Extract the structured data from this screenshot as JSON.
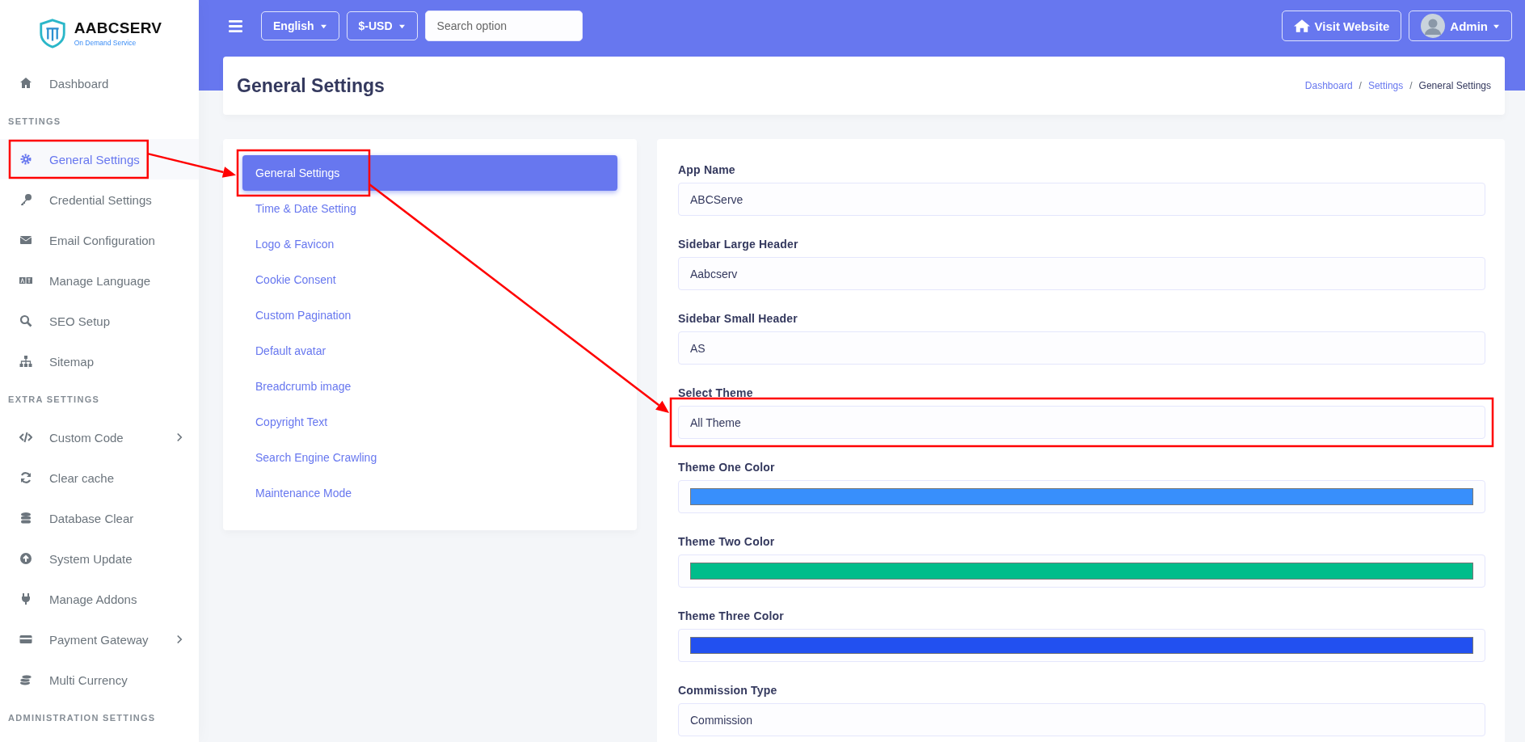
{
  "logo": {
    "title": "AABCSERV",
    "subtitle": "On Demand Service"
  },
  "sidebar": {
    "sections": [
      {
        "items": [
          {
            "label": "Dashboard",
            "selected": false,
            "expandable": false,
            "highlighted": false
          }
        ]
      },
      {
        "heading": "SETTINGS",
        "items": [
          {
            "label": "General Settings",
            "selected": true,
            "expandable": false,
            "highlighted": true
          },
          {
            "label": "Credential Settings",
            "selected": false,
            "expandable": false,
            "highlighted": false
          },
          {
            "label": "Email Configuration",
            "selected": false,
            "expandable": false,
            "highlighted": false
          },
          {
            "label": "Manage Language",
            "selected": false,
            "expandable": false,
            "highlighted": false
          },
          {
            "label": "SEO Setup",
            "selected": false,
            "expandable": false,
            "highlighted": false
          },
          {
            "label": "Sitemap",
            "selected": false,
            "expandable": false,
            "highlighted": false
          }
        ]
      },
      {
        "heading": "EXTRA SETTINGS",
        "items": [
          {
            "label": "Custom Code",
            "selected": false,
            "expandable": true,
            "highlighted": false
          },
          {
            "label": "Clear cache",
            "selected": false,
            "expandable": false,
            "highlighted": false
          },
          {
            "label": "Database Clear",
            "selected": false,
            "expandable": false,
            "highlighted": false
          },
          {
            "label": "System Update",
            "selected": false,
            "expandable": false,
            "highlighted": false
          },
          {
            "label": "Manage Addons",
            "selected": false,
            "expandable": false,
            "highlighted": false
          },
          {
            "label": "Payment Gateway",
            "selected": false,
            "expandable": true,
            "highlighted": false
          },
          {
            "label": "Multi Currency",
            "selected": false,
            "expandable": false,
            "highlighted": false
          }
        ]
      },
      {
        "heading": "ADMINISTRATION SETTINGS"
      }
    ]
  },
  "topbar": {
    "language": "English",
    "currency": "$-USD",
    "search": {
      "placeholder": "Search option"
    },
    "visit_button": "Visit Website",
    "user": "Admin"
  },
  "header": {
    "title": "General Settings",
    "separator": "/",
    "breadcrumb": [
      {
        "label": "Dashboard",
        "current": false
      },
      {
        "label": "Settings",
        "current": false
      },
      {
        "label": "General Settings",
        "current": true
      }
    ]
  },
  "settings_menu": [
    {
      "label": "General Settings",
      "selected": true,
      "highlighted": true
    },
    {
      "label": "Time & Date Setting",
      "selected": false,
      "highlighted": false
    },
    {
      "label": "Logo & Favicon",
      "selected": false,
      "highlighted": false
    },
    {
      "label": "Cookie Consent",
      "selected": false,
      "highlighted": false
    },
    {
      "label": "Custom Pagination",
      "selected": false,
      "highlighted": false
    },
    {
      "label": "Default avatar",
      "selected": false,
      "highlighted": false
    },
    {
      "label": "Breadcrumb image",
      "selected": false,
      "highlighted": false
    },
    {
      "label": "Copyright Text",
      "selected": false,
      "highlighted": false
    },
    {
      "label": "Search Engine Crawling",
      "selected": false,
      "highlighted": false
    },
    {
      "label": "Maintenance Mode",
      "selected": false,
      "highlighted": false
    }
  ],
  "form": {
    "fields": [
      {
        "kind": "text",
        "label": "App Name",
        "value": "ABCServe",
        "highlighted": false
      },
      {
        "kind": "text",
        "label": "Sidebar Large Header",
        "value": "Aabcserv",
        "highlighted": false
      },
      {
        "kind": "text",
        "label": "Sidebar Small Header",
        "value": "AS",
        "highlighted": false
      },
      {
        "kind": "text",
        "label": "Select Theme",
        "value": "All Theme",
        "highlighted": true
      },
      {
        "kind": "color",
        "label": "Theme One Color",
        "color": "#388ffc",
        "highlighted": false
      },
      {
        "kind": "color",
        "label": "Theme Two Color",
        "color": "#00bd8b",
        "highlighted": false
      },
      {
        "kind": "color",
        "label": "Theme Three Color",
        "color": "#2250f0",
        "highlighted": false
      },
      {
        "kind": "text",
        "label": "Commission Type",
        "value": "Commission",
        "highlighted": false
      }
    ]
  }
}
